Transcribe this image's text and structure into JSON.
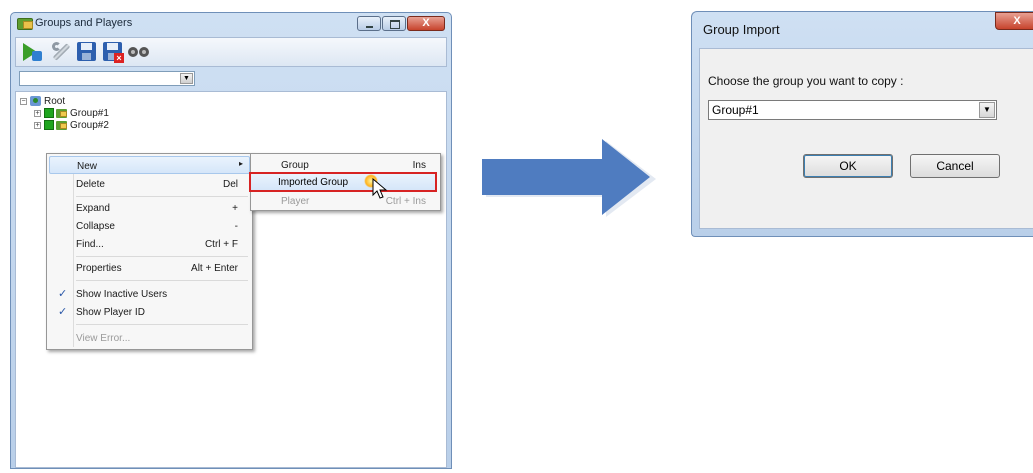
{
  "groups_window": {
    "title": "Groups and Players",
    "toolbar_icons": [
      "run-green-arrow-icon",
      "wrench-icon",
      "save-disk-icon",
      "save-delete-icon",
      "binoculars-icon"
    ],
    "combo_value": "",
    "tree": {
      "root_label": "Root",
      "groups": [
        {
          "label": "Group#1",
          "expander": "+"
        },
        {
          "label": "Group#2",
          "expander": "+"
        }
      ],
      "root_expander": "−"
    }
  },
  "context_menu": {
    "items": [
      {
        "label": "New",
        "shortcut": "",
        "submenu": true,
        "highlighted": true
      },
      {
        "label": "Delete",
        "shortcut": "Del"
      },
      {
        "label": "Expand",
        "shortcut": "+"
      },
      {
        "label": "Collapse",
        "shortcut": "-"
      },
      {
        "label": "Find...",
        "shortcut": "Ctrl + F"
      },
      {
        "label": "Properties",
        "shortcut": "Alt + Enter"
      },
      {
        "label": "Show Inactive Users",
        "checked": true
      },
      {
        "label": "Show Player ID",
        "checked": true
      },
      {
        "label": "View Error...",
        "disabled": true
      }
    ],
    "submenu": [
      {
        "label": "Group",
        "shortcut": "Ins"
      },
      {
        "label": "Imported Group",
        "shortcut": "",
        "highlighted": true
      },
      {
        "label": "Player",
        "shortcut": "Ctrl + Ins",
        "disabled": true
      }
    ],
    "check_glyph": "✓",
    "submenu_arrow": "▸"
  },
  "dialog": {
    "title": "Group Import",
    "close_glyph": "X",
    "prompt": "Choose the group you want to copy :",
    "selected_group": "Group#1",
    "ok_label": "OK",
    "cancel_label": "Cancel"
  },
  "colors": {
    "highlight_box": "#d72323",
    "arrow_fill": "#4f7cc0",
    "window_frame": "#b9cfe9"
  }
}
